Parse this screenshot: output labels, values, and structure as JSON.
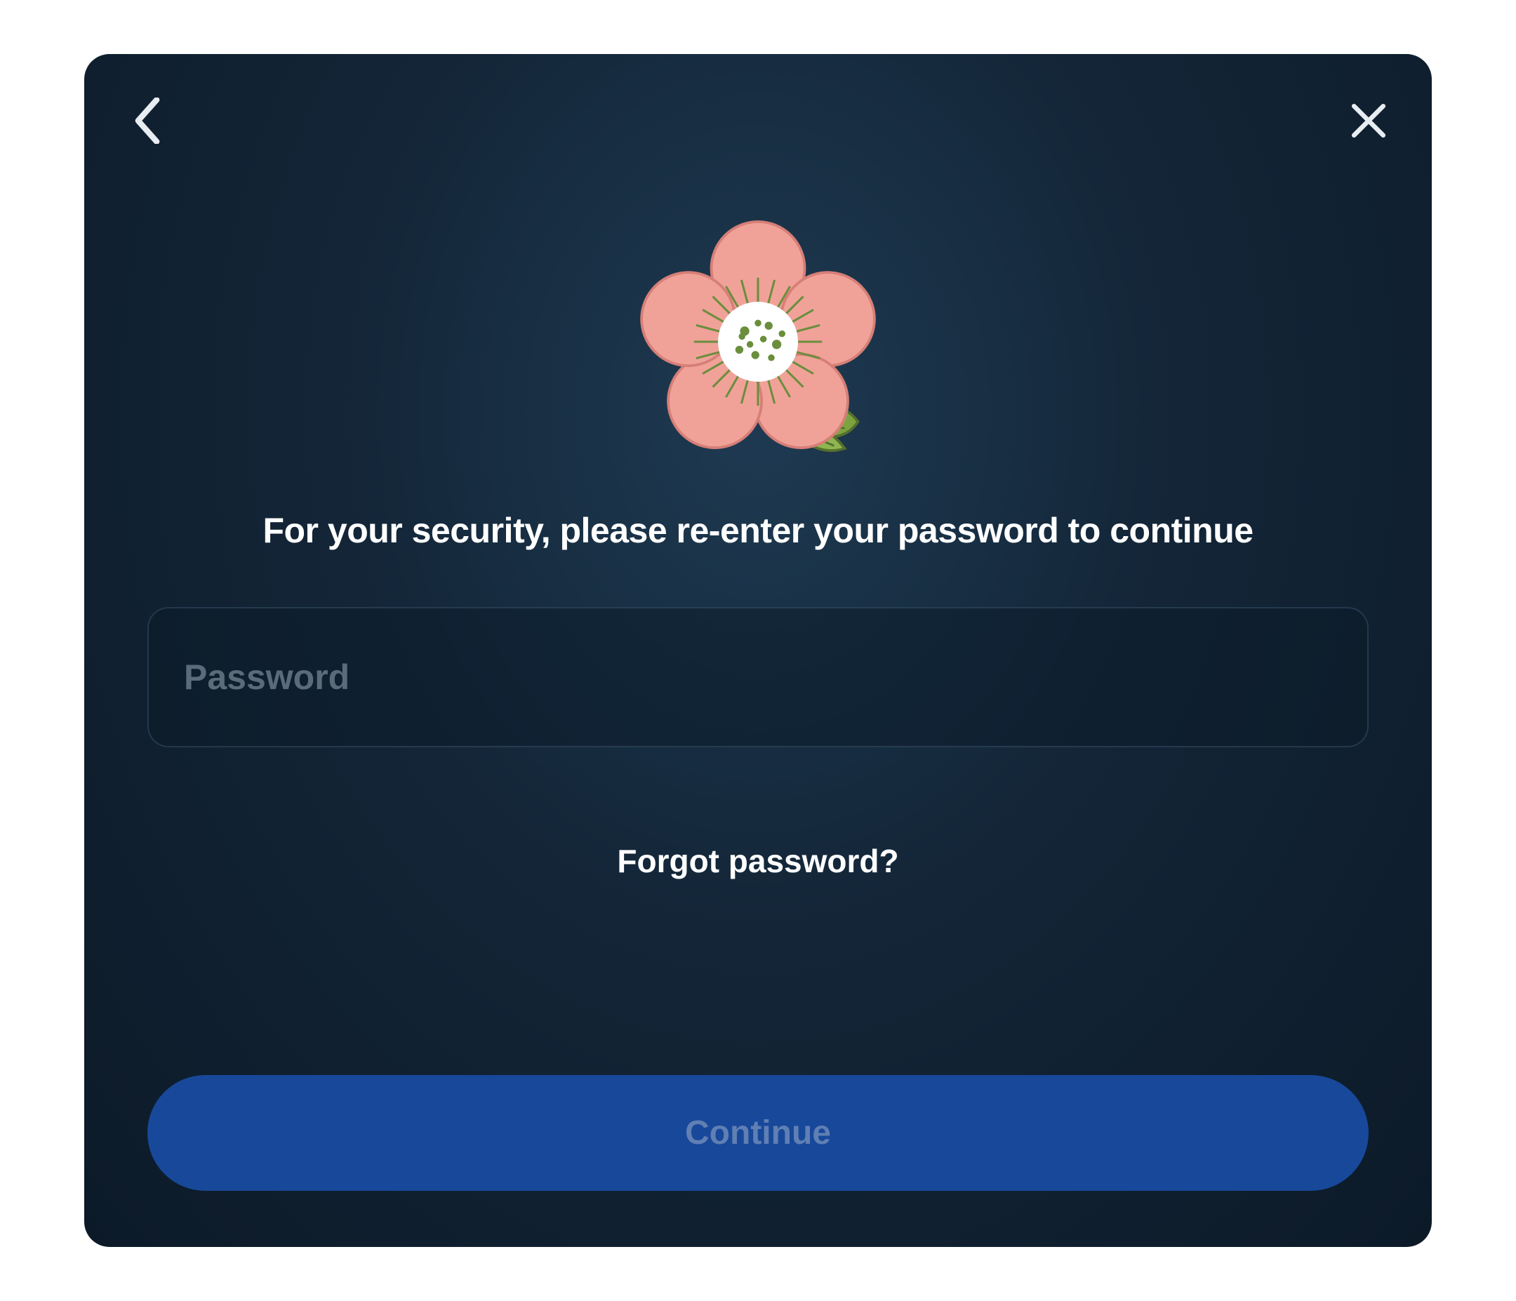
{
  "dialog": {
    "heading": "For your security, please re-enter your password to continue",
    "password_placeholder": "Password",
    "password_value": "",
    "forgot_label": "Forgot password?",
    "continue_label": "Continue"
  },
  "icons": {
    "back": "chevron-left-icon",
    "close": "close-icon",
    "avatar": "flower-avatar"
  },
  "colors": {
    "background_dark": "#0c1a28",
    "background_mid": "#1e3a52",
    "button_primary": "#18489a",
    "button_text_disabled": "#607fb3",
    "placeholder": "#5a6c7a",
    "text": "#ffffff",
    "flower_petal": "#f0a299",
    "flower_center": "#ffffff",
    "flower_seeds": "#6b8e3d",
    "leaf": "#7da340"
  }
}
